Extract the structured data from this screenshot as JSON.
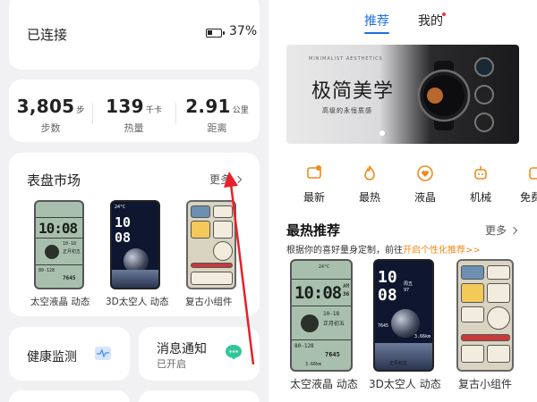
{
  "left": {
    "connection": {
      "status": "已连接",
      "battery_percent": "37%",
      "battery_level": 0.37
    },
    "stats": [
      {
        "value": "3,805",
        "unit": "步",
        "label": "步数"
      },
      {
        "value": "139",
        "unit": "千卡",
        "label": "热量"
      },
      {
        "value": "2.91",
        "unit": "公里",
        "label": "距离"
      }
    ],
    "market": {
      "title": "表盘市场",
      "more": "更多",
      "faces": [
        {
          "caption": "太空液晶 动态"
        },
        {
          "caption": "3D太空人 动态"
        },
        {
          "caption": "复古小组件"
        }
      ]
    },
    "health": {
      "label": "健康监测"
    },
    "notify": {
      "label": "消息通知",
      "status": "已开启"
    }
  },
  "right": {
    "tabs": [
      {
        "label": "推荐"
      },
      {
        "label": "我的"
      }
    ],
    "banner": {
      "title": "极简美学",
      "subtitle": "MINIMALIST AESTHETICS",
      "tagline": "高级的永恒质感"
    },
    "categories": [
      {
        "label": "最新",
        "icon": "new-badge-icon"
      },
      {
        "label": "最热",
        "icon": "flame-icon"
      },
      {
        "label": "液晶",
        "icon": "heart-icon"
      },
      {
        "label": "机械",
        "icon": "robot-icon"
      },
      {
        "label": "免费专",
        "icon": "free-icon"
      }
    ],
    "hot": {
      "title": "最热推荐",
      "more": "更多",
      "desc": "根据你的喜好量身定制，前往",
      "link": "开启个性化推荐>>",
      "faces": [
        {
          "caption": "太空液晶 动态"
        },
        {
          "caption": "3D太空人 动态"
        },
        {
          "caption": "复古小组件"
        }
      ]
    }
  },
  "watch_face": {
    "time_hours": "10",
    "time_minutes": "08",
    "time_ampm": "AM",
    "time_seconds": "36",
    "date": "10-18",
    "weekday": "周五",
    "temperature": "24°C",
    "temp_range": "20/24°C",
    "lunar": "正月初五",
    "heart_rate": "80-128",
    "spo2": "97",
    "steps": "7645",
    "sleep": "7h30m",
    "distance": "3.66km",
    "pressure": "97/205"
  },
  "colors": {
    "accent": "#1f6fe5",
    "link_orange": "#f08a1a",
    "category_icon": "#f08a1a",
    "arrow_red": "#e8202a"
  }
}
